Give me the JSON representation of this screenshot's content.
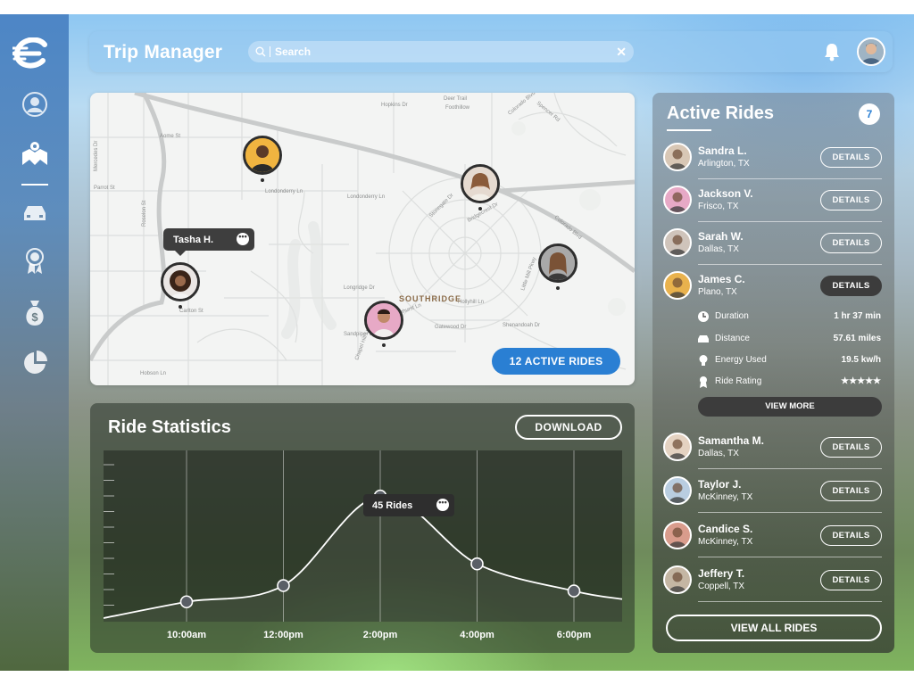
{
  "app": {
    "title": "Trip Manager"
  },
  "search": {
    "placeholder": "Search",
    "clear_label": "✕"
  },
  "sidebar": {
    "logo": "e-logo-icon",
    "items": [
      {
        "icon": "profile-icon"
      },
      {
        "icon": "map-icon",
        "active": true
      },
      {
        "icon": "car-icon"
      },
      {
        "icon": "award-ribbon-icon"
      },
      {
        "icon": "money-bag-icon"
      },
      {
        "icon": "pie-chart-icon"
      }
    ]
  },
  "map": {
    "area_label": "SOUTHRIDGE",
    "tooltip": {
      "name": "Tasha H.",
      "more": "•••"
    },
    "active_rides_button": "12 ACTIVE RIDES",
    "streets": [
      "Hopkins Dr",
      "Deer Trail",
      "Foothillow",
      "Colorado Blvd",
      "Spencer Rd",
      "Aome St",
      "Londonderry Ln",
      "Londonderry Ln",
      "Mercedes Dr",
      "Parrot St",
      "Roselon St",
      "Stonegate Dr",
      "Bridgecrest Dr",
      "Hollyhill Ln",
      "Sandpiper Ln",
      "Gatewood Dr",
      "Lynhurst Ln",
      "Hobson Ln",
      "Longridge Dr",
      "Shenandoah Dr",
      "Little Mill Pkwy",
      "Chapel Hill Ln",
      "Colorado Blvd",
      "Carlton St"
    ],
    "markers": [
      "rider-1",
      "rider-2",
      "rider-3",
      "rider-4",
      "rider-5",
      "rider-6"
    ]
  },
  "stats": {
    "title": "Ride Statistics",
    "download_label": "DOWNLOAD",
    "tooltip": {
      "label": "45 Rides",
      "more": "•••"
    }
  },
  "chart_data": {
    "type": "line",
    "title": "Ride Statistics",
    "categories": [
      "10:00am",
      "12:00pm",
      "2:00pm",
      "4:00pm",
      "6:00pm"
    ],
    "series": [
      {
        "values": [
          6,
          12,
          45,
          20,
          10
        ]
      }
    ],
    "highlight": {
      "x": "2:00pm",
      "value": 45,
      "label": "45 Rides"
    },
    "grid": "vertical",
    "ylim": [
      0,
      50
    ]
  },
  "rides": {
    "title": "Active Rides",
    "count": "7",
    "details_label": "DETAILS",
    "view_more_label": "VIEW MORE",
    "view_all_label": "VIEW ALL RIDES",
    "list": [
      {
        "name": "Sandra L.",
        "location": "Arlington, TX",
        "avatar_color": "#d8c7b5"
      },
      {
        "name": "Jackson V.",
        "location": "Frisco, TX",
        "avatar_color": "#e7a9c6"
      },
      {
        "name": "Sarah W.",
        "location": "Dallas, TX",
        "avatar_color": "#cfc4bb"
      },
      {
        "name": "James C.",
        "location": "Plano, TX",
        "avatar_color": "#e9b24d",
        "expanded": true
      },
      {
        "name": "Samantha M.",
        "location": "Dallas, TX",
        "avatar_color": "#e4d2c1"
      },
      {
        "name": "Taylor J.",
        "location": "McKinney, TX",
        "avatar_color": "#b9cde0"
      },
      {
        "name": "Candice S.",
        "location": "McKinney, TX",
        "avatar_color": "#d99c8c"
      },
      {
        "name": "Jeffery T.",
        "location": "Coppell, TX",
        "avatar_color": "#c4b6a3"
      }
    ],
    "details": [
      {
        "icon": "clock-icon",
        "label": "Duration",
        "value": "1 hr 37 min"
      },
      {
        "icon": "car-icon",
        "label": "Distance",
        "value": "57.61 miles"
      },
      {
        "icon": "lightbulb-icon",
        "label": "Energy Used",
        "value": "19.5 kw/h"
      },
      {
        "icon": "ribbon-icon",
        "label": "Ride Rating",
        "value": "★★★★★"
      }
    ]
  },
  "colors": {
    "accent": "#2a7fd3",
    "dark": "#3c3c3c"
  }
}
